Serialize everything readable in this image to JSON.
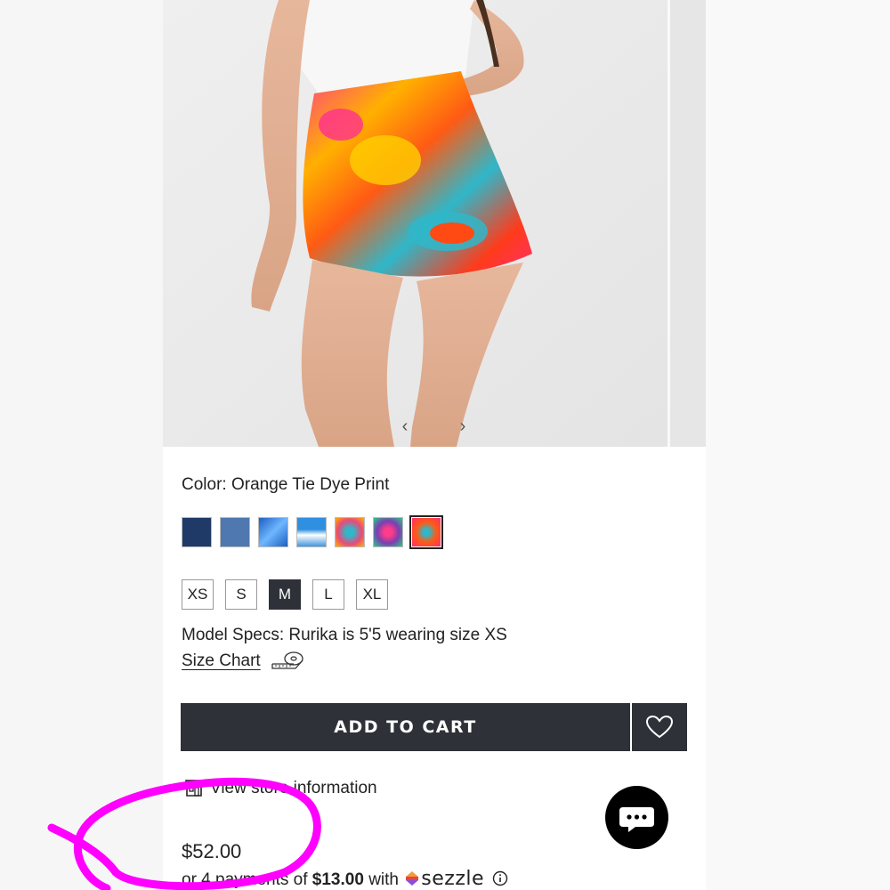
{
  "product": {
    "color_label": "Color: Orange Tie Dye Print",
    "swatches": [
      {
        "name": "Dark Denim",
        "color": "#1f3a66"
      },
      {
        "name": "Light Denim",
        "color": "#4f78b0"
      },
      {
        "name": "Blue Marble",
        "color": "#2a6fcf"
      },
      {
        "name": "Sky Clouds",
        "color": "#3f95e0"
      },
      {
        "name": "Pink Tie Dye",
        "color": "#e94a7a"
      },
      {
        "name": "Purple Tie Dye",
        "color": "#7a3fb0"
      },
      {
        "name": "Orange Tie Dye Print",
        "color": "#e8462a"
      }
    ],
    "sizes": [
      "XS",
      "S",
      "M",
      "L",
      "XL"
    ],
    "selected_size": "M",
    "model_specs": "Model Specs: Rurika is 5'5 wearing size XS",
    "size_chart_label": "Size Chart",
    "add_to_cart_label": "ADD TO CART",
    "store_info_label": "View store information",
    "price": "$52.00",
    "installments": {
      "prefix": "or 4 payments of ",
      "amount": "$13.00",
      "middle": " with ",
      "provider": "sezzle"
    }
  },
  "colors": {
    "button_dark": "#2e3138",
    "annotation_magenta": "#ff00ff"
  },
  "icons": [
    "chevron-left-icon",
    "chevron-right-icon",
    "tape-measure-icon",
    "heart-icon",
    "store-icon",
    "sezzle-logo-icon",
    "info-icon",
    "chat-icon"
  ]
}
